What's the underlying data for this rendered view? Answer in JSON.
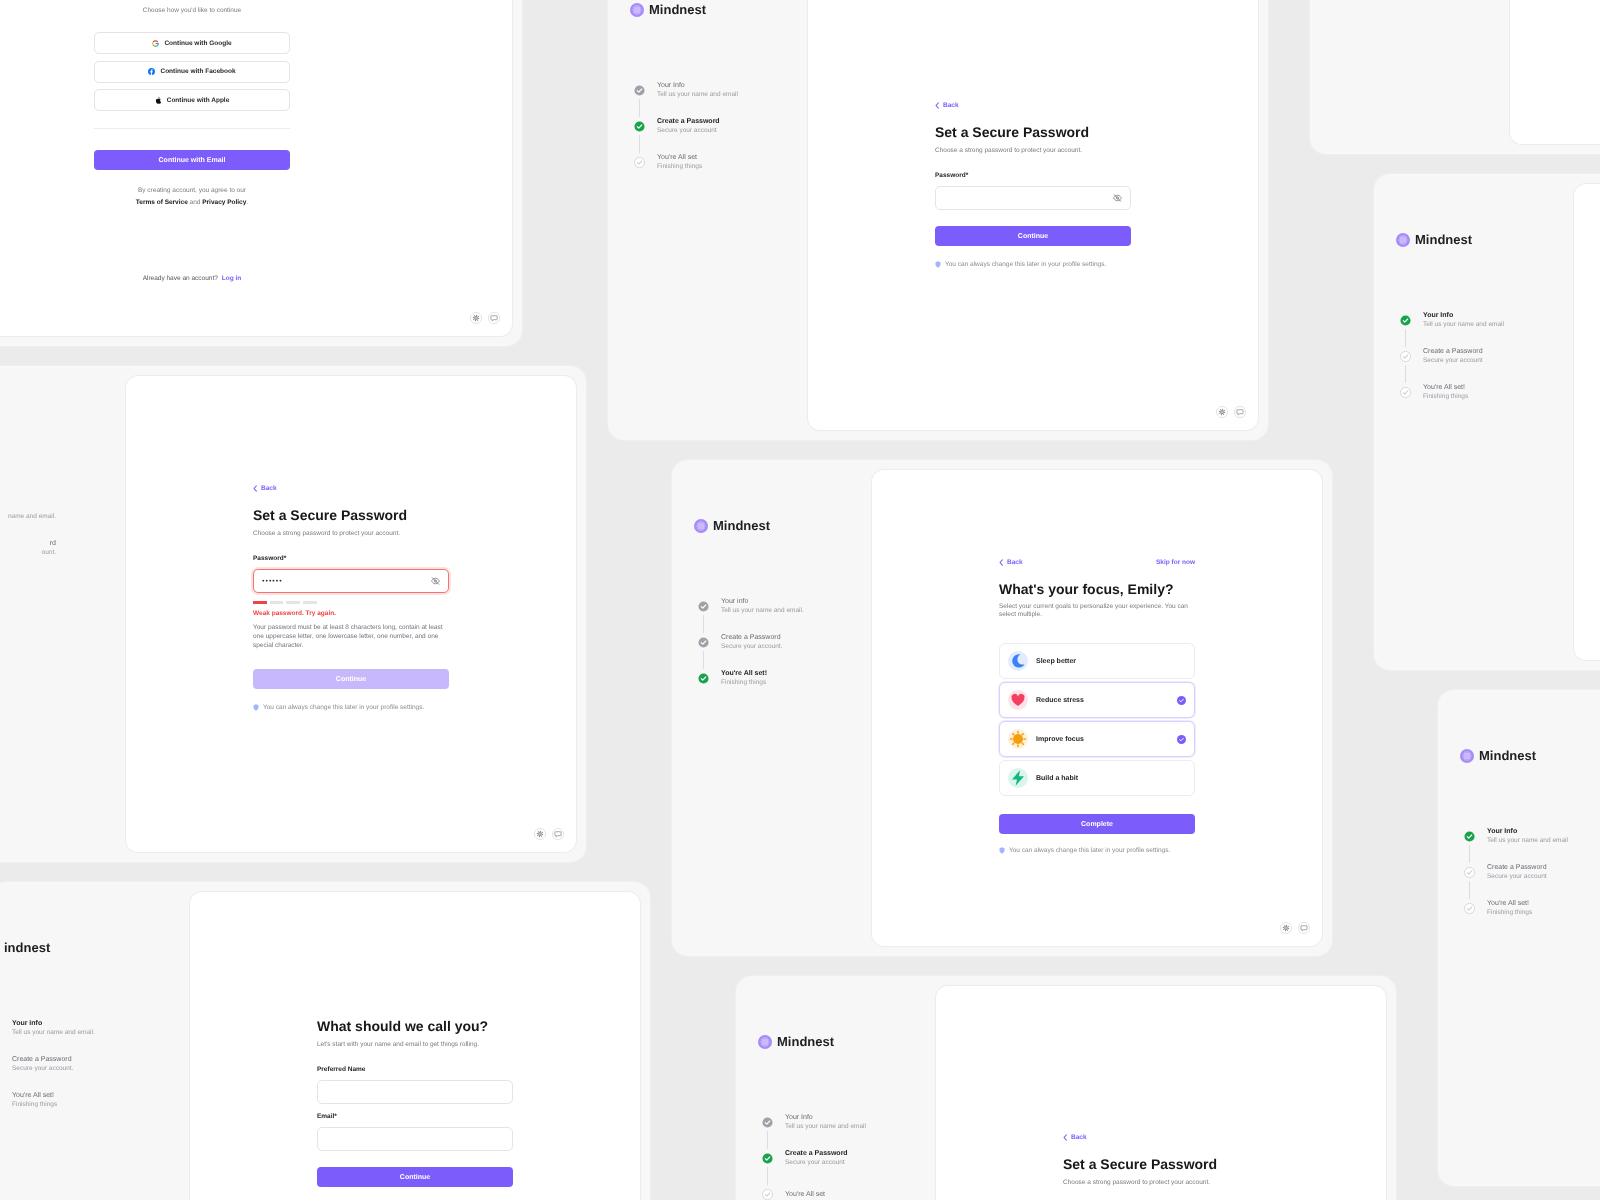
{
  "columns": [
    [
      {
        "kind": "signup",
        "corner_buttons": true,
        "main": [
          {
            "kind": "subtitle",
            "text": "Choose how you'd like to continue"
          },
          {
            "kind": "social",
            "text": "Continue with Google"
          },
          {
            "kind": "social",
            "text": "Continue with Facebook"
          },
          {
            "kind": "social",
            "text": "Continue with Apple"
          },
          {
            "kind": "divider"
          },
          {
            "kind": "button",
            "text": "Continue with Email",
            "disabled": false
          },
          {
            "kind": "terms",
            "text": "By creating account, you agree to our **Terms of Service** and **Privacy Policy**."
          },
          {
            "kind": "footer",
            "text": "Already have an account?",
            "link": "Log in"
          }
        ]
      },
      {
        "kind": "password-error",
        "corner_buttons": true,
        "sidebar": {
          "kind": "ends",
          "steps": [
            {
              "subtitle": "name and email."
            },
            {
              "title": "rd",
              "subtitle": "ount."
            }
          ]
        },
        "main": [
          {
            "kind": "back",
            "text": "Back"
          },
          {
            "kind": "title",
            "text": "Set a Secure Password"
          },
          {
            "kind": "subtitle",
            "text": "Choose a strong password to protect your account."
          },
          {
            "kind": "password-field",
            "label": "Password*",
            "value": "••••••",
            "error": true
          },
          {
            "kind": "strength",
            "level": 0.25
          },
          {
            "kind": "error",
            "text": "Weak password. Try again."
          },
          {
            "kind": "help",
            "text": "Your password must be at least 8 characters long, contain at least one uppercase letter, one lowercase letter, one number, and one special character."
          },
          {
            "kind": "button",
            "text": "Continue",
            "disabled": true
          },
          {
            "kind": "hint",
            "text": "You can always change this later in your profile settings."
          }
        ]
      },
      {
        "kind": "name",
        "sidebar": {
          "kind": "edge",
          "logo": "indnest",
          "steps": [
            {
              "title": "Your info",
              "subtitle": "Tell us your name and email.",
              "kind": "current"
            },
            {
              "title": "Create a Password",
              "subtitle": "Secure your account.",
              "kind": "upcoming"
            },
            {
              "title": "You're All set!",
              "subtitle": "Finishing things",
              "kind": "upcoming"
            }
          ]
        },
        "main": [
          {
            "kind": "title",
            "text": "What should we call you?"
          },
          {
            "kind": "subtitle",
            "text": "Let's start with your name and email to get things rolling."
          },
          {
            "kind": "text-field",
            "label": "Preferred Name"
          },
          {
            "kind": "text-field",
            "label": "Email*"
          },
          {
            "kind": "button",
            "text": "Continue",
            "disabled": false
          }
        ]
      }
    ],
    [
      {
        "kind": "password",
        "corner_buttons": true,
        "sidebar": {
          "kind": "full",
          "logo": "Mindnest",
          "steps": [
            {
              "title": "Your Info",
              "subtitle": "Tell us your name and email",
              "kind": "done"
            },
            {
              "title": "Create a Password",
              "subtitle": "Secure your account",
              "kind": "current"
            },
            {
              "title": "You're All set",
              "subtitle": "Finishing things",
              "kind": "upcoming"
            }
          ]
        },
        "main": [
          {
            "kind": "back",
            "text": "Back"
          },
          {
            "kind": "title",
            "text": "Set a Secure Password"
          },
          {
            "kind": "subtitle",
            "text": "Choose a strong password to protect your account."
          },
          {
            "kind": "password-field",
            "label": "Password*",
            "error": false
          },
          {
            "kind": "button",
            "text": "Continue",
            "disabled": false
          },
          {
            "kind": "hint",
            "text": "You can always change this later in your profile settings."
          }
        ]
      },
      {
        "kind": "focus",
        "corner_buttons": true,
        "sidebar": {
          "kind": "full",
          "logo": "Mindnest",
          "steps": [
            {
              "title": "Your info",
              "subtitle": "Tell us your name and email.",
              "kind": "done"
            },
            {
              "title": "Create a Password",
              "subtitle": "Secure your account.",
              "kind": "done"
            },
            {
              "title": "You're All set!",
              "subtitle": "Finishing things",
              "kind": "current"
            }
          ]
        },
        "main": [
          {
            "kind": "back",
            "text": "Back",
            "skip": "Skip for now"
          },
          {
            "kind": "title",
            "text": "What's your focus, Emily?"
          },
          {
            "kind": "subtitle",
            "text": "Select your current goals to personalize your experience. You can select multiple."
          },
          {
            "kind": "option",
            "text": "Sleep better",
            "selected": false,
            "color": "#3b82f6"
          },
          {
            "kind": "option",
            "text": "Reduce stress",
            "selected": true,
            "color": "#f43f5e"
          },
          {
            "kind": "option",
            "text": "Improve focus",
            "selected": true,
            "color": "#f59e0b"
          },
          {
            "kind": "option",
            "text": "Build a habit",
            "selected": false,
            "color": "#10b981"
          },
          {
            "kind": "button",
            "text": "Complete",
            "disabled": false
          },
          {
            "kind": "hint",
            "text": "You can always change this later in your profile settings."
          }
        ]
      },
      {
        "kind": "password",
        "sidebar": {
          "kind": "full",
          "logo": "Mindnest",
          "steps": [
            {
              "title": "Your Info",
              "subtitle": "Tell us your name and email",
              "kind": "done"
            },
            {
              "title": "Create a Password",
              "subtitle": "Secure your account",
              "kind": "current"
            },
            {
              "title": "You're All set",
              "kind": "upcoming"
            }
          ]
        },
        "main": [
          {
            "kind": "back",
            "text": "Back"
          },
          {
            "kind": "title",
            "text": "Set a Secure Password"
          },
          {
            "kind": "subtitle",
            "text": "Choose a strong password to protect your account."
          }
        ]
      }
    ],
    [
      {
        "kind": "blank"
      },
      {
        "kind": "blank",
        "sidebar": {
          "kind": "full",
          "logo": "Mindnest",
          "steps": [
            {
              "title": "Your Info",
              "subtitle": "Tell us your name and email",
              "kind": "current"
            },
            {
              "title": "Create a Password",
              "subtitle": "Secure your account",
              "kind": "upcoming"
            },
            {
              "title": "You're All set!",
              "subtitle": "Finishing things",
              "kind": "upcoming"
            }
          ]
        }
      },
      {
        "kind": "blank",
        "sidebar": {
          "kind": "full",
          "logo": "Mindnest",
          "steps": [
            {
              "title": "Your Info",
              "subtitle": "Tell us your name and email",
              "kind": "current"
            },
            {
              "title": "Create a Password",
              "subtitle": "Secure your account",
              "kind": "upcoming"
            },
            {
              "title": "You're All set!",
              "subtitle": "Finishing things",
              "kind": "upcoming"
            }
          ]
        }
      }
    ]
  ]
}
